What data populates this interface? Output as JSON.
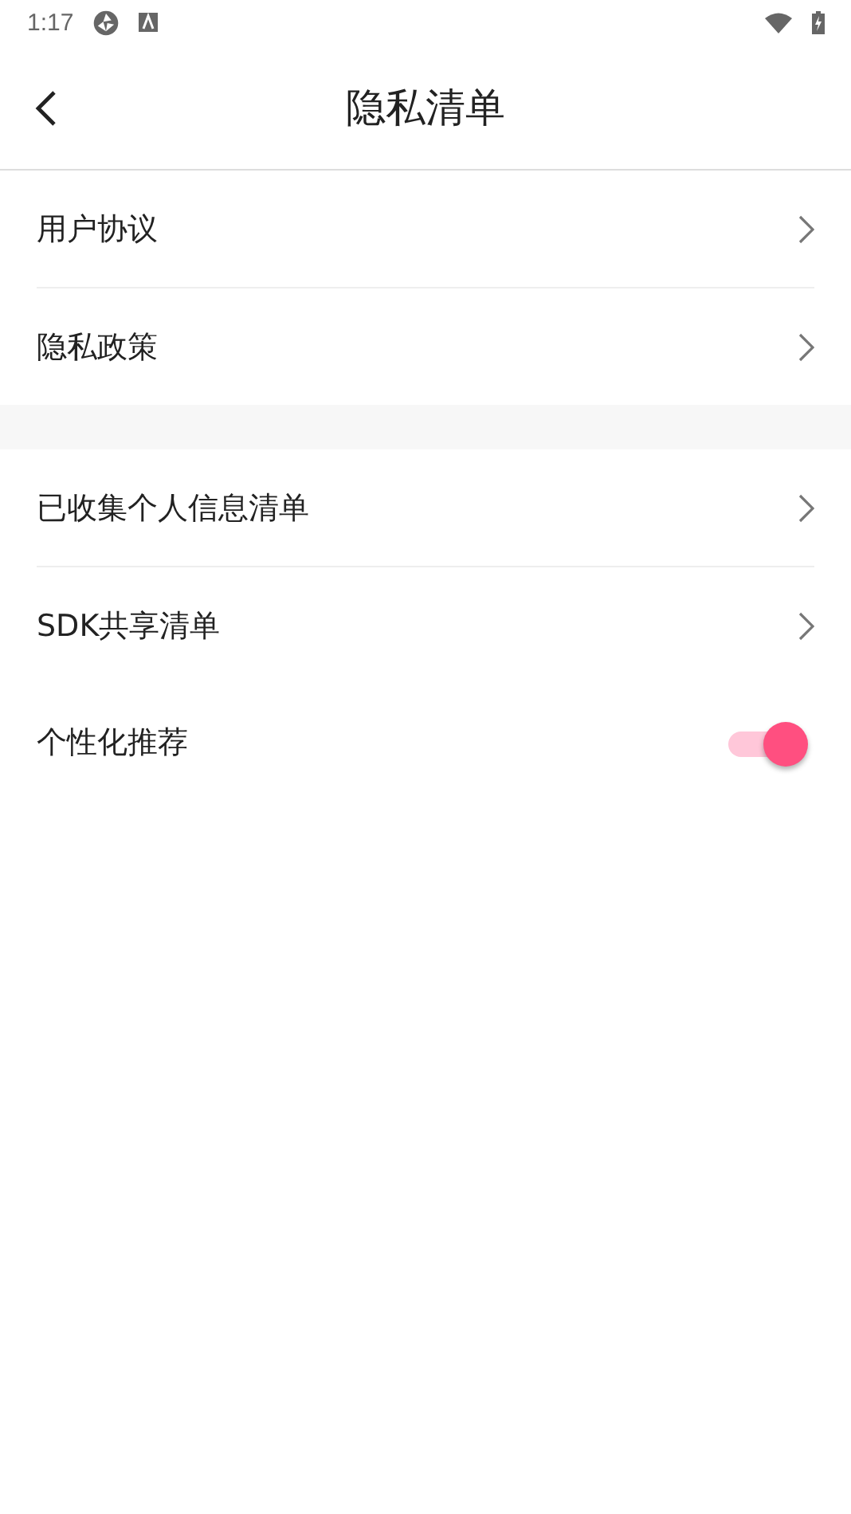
{
  "status_bar": {
    "time": "1:17"
  },
  "header": {
    "title": "隐私清单"
  },
  "sections": [
    {
      "items": [
        {
          "label": "用户协议",
          "kind": "link"
        },
        {
          "label": "隐私政策",
          "kind": "link"
        }
      ]
    },
    {
      "items": [
        {
          "label": "已收集个人信息清单",
          "kind": "link"
        },
        {
          "label": "SDK共享清单",
          "kind": "link"
        },
        {
          "label": "个性化推荐",
          "kind": "toggle",
          "on": true
        }
      ]
    }
  ]
}
